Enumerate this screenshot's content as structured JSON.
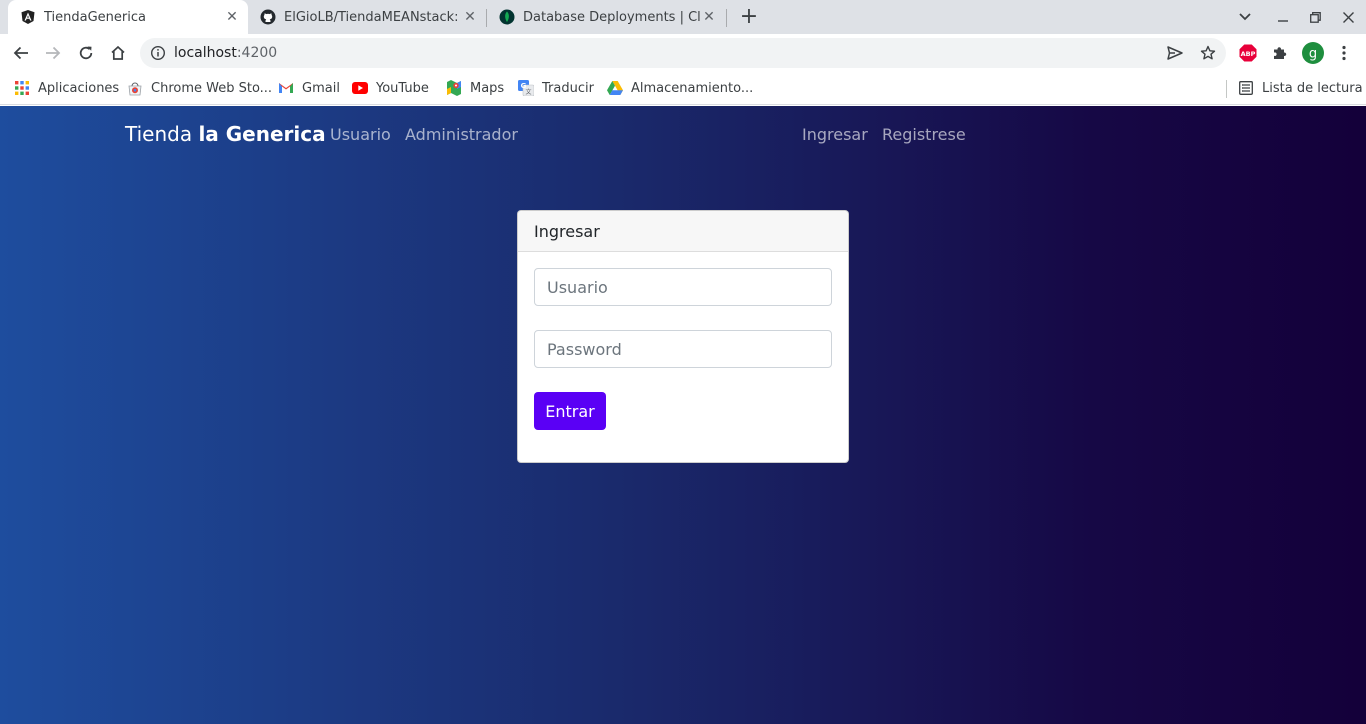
{
  "browser": {
    "tabs": [
      {
        "title": "TiendaGenerica",
        "icon": "angular-icon",
        "active": true
      },
      {
        "title": "ElGioLB/TiendaMEANstack: ti",
        "icon": "github-icon",
        "active": false
      },
      {
        "title": "Database Deployments | Clou",
        "icon": "mongodb-leaf-icon",
        "active": false
      }
    ],
    "url_host": "localhost",
    "url_port": ":4200",
    "profile_initial": "g",
    "extension_label": "ABP",
    "bookmarks": [
      {
        "label": "Aplicaciones",
        "icon": "apps-grid-icon"
      },
      {
        "label": "Chrome Web Sto...",
        "icon": "chrome-webstore-icon"
      },
      {
        "label": "Gmail",
        "icon": "gmail-icon"
      },
      {
        "label": "YouTube",
        "icon": "youtube-icon"
      },
      {
        "label": "Maps",
        "icon": "maps-icon"
      },
      {
        "label": "Traducir",
        "icon": "translate-icon"
      },
      {
        "label": "Almacenamiento...",
        "icon": "drive-icon"
      }
    ],
    "reading_list": "Lista de lectura"
  },
  "navbar": {
    "brand_light": "Tienda ",
    "brand_bold": "la Generica",
    "links_left": [
      "Usuario",
      "Administrador"
    ],
    "links_right": [
      "Ingresar",
      "Registrese"
    ]
  },
  "login": {
    "header": "Ingresar",
    "username_placeholder": "Usuario",
    "password_placeholder": "Password",
    "submit_label": "Entrar"
  },
  "colors": {
    "primary_button": "#5a00f5",
    "gradient_start": "#1e4d9e",
    "gradient_end": "#14003a"
  }
}
